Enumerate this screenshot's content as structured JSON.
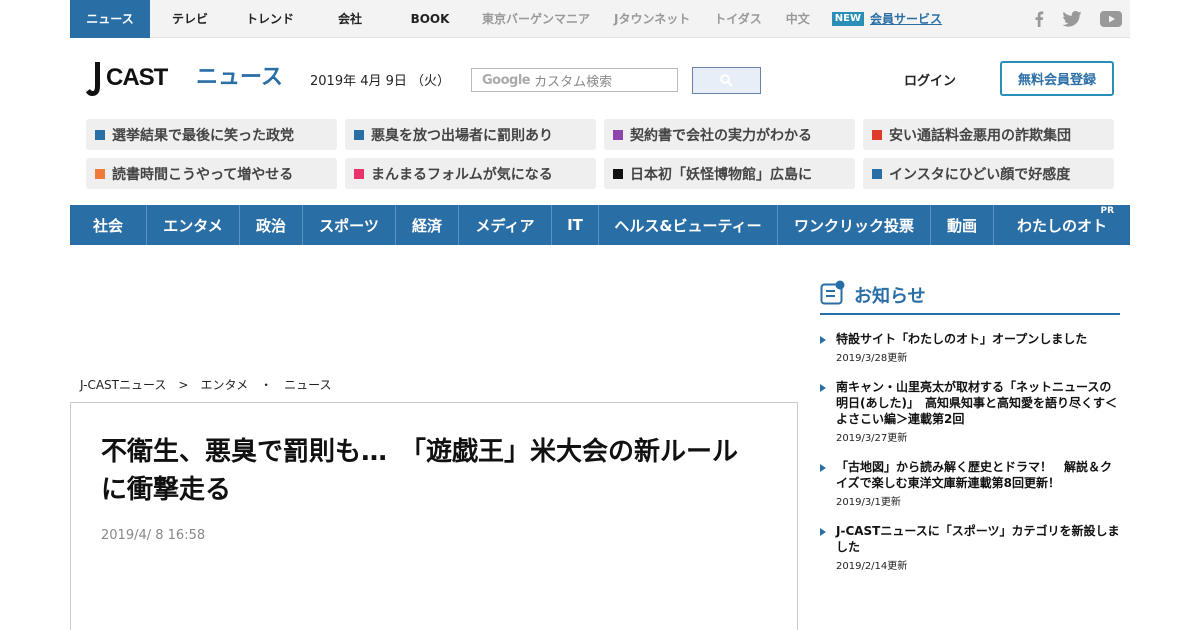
{
  "topbar": {
    "tabs": [
      {
        "label": "ニュース"
      },
      {
        "label": "テレビ"
      },
      {
        "label": "トレンド"
      },
      {
        "label": "会社"
      },
      {
        "label": "BOOK"
      }
    ],
    "grey_links": [
      "東京バーゲンマニア",
      "Jタウンネット",
      "トイダス",
      "中文"
    ],
    "new_badge": "NEW",
    "member_service": "会員サービス"
  },
  "header": {
    "logo_text": "J-CAST ニュース",
    "date": "2019年 4月 9日 （火）",
    "search_brand": "Google",
    "search_placeholder": "カスタム検索",
    "login": "ログイン",
    "register": "無料会員登録"
  },
  "topics": [
    {
      "label": "選挙結果で最後に笑った政党",
      "color": "#2a6ea6"
    },
    {
      "label": "悪臭を放つ出場者に罰則あり",
      "color": "#2a6ea6"
    },
    {
      "label": "契約書で会社の実力がわかる",
      "color": "#8e44ad"
    },
    {
      "label": "安い通話料金悪用の詐欺集団",
      "color": "#e03a2a"
    },
    {
      "label": "読書時間こうやって増やせる",
      "color": "#f07a3a"
    },
    {
      "label": "まんまるフォルムが気になる",
      "color": "#e8336d"
    },
    {
      "label": "日本初「妖怪博物館」広島に",
      "color": "#111111"
    },
    {
      "label": "インスタにひどい顔で好感度",
      "color": "#2a6ea6"
    }
  ],
  "categories": [
    {
      "label": "社会"
    },
    {
      "label": "エンタメ"
    },
    {
      "label": "政治"
    },
    {
      "label": "スポーツ"
    },
    {
      "label": "経済"
    },
    {
      "label": "メディア"
    },
    {
      "label": "IT"
    },
    {
      "label": "ヘルス&ビューティー"
    },
    {
      "label": "ワンクリック投票"
    },
    {
      "label": "動画"
    },
    {
      "label": "わたしのオト"
    }
  ],
  "pr_badge": "PR",
  "breadcrumb": {
    "home": "J-CASTニュース",
    "sep1": "　>　",
    "section": "エンタメ",
    "sep2": "　・　",
    "sub": "ニュース"
  },
  "article": {
    "title": "不衛生、悪臭で罰則も…　「遊戯王」米大会の新ルールに衝撃走る",
    "timestamp": "2019/4/ 8 16:58"
  },
  "notices": {
    "heading": "お知らせ",
    "items": [
      {
        "title": "特設サイト「わたしのオト」オープンしました",
        "date": "2019/3/28更新"
      },
      {
        "title": "南キャン・山里亮太が取材する「ネットニュースの明日(あした)」　高知県知事と高知愛を語り尽くす＜よさこい編＞連載第2回",
        "date": "2019/3/27更新"
      },
      {
        "title": "「古地図」から読み解く歴史とドラマ！　解説＆クイズで楽しむ東洋文庫新連載第8回更新！",
        "date": "2019/3/1更新"
      },
      {
        "title": "J-CASTニュースに「スポーツ」カテゴリを新設しました",
        "date": "2019/2/14更新"
      }
    ]
  },
  "colors": {
    "accent": "#2a6ea6",
    "register_border": "#2a8fb8"
  }
}
